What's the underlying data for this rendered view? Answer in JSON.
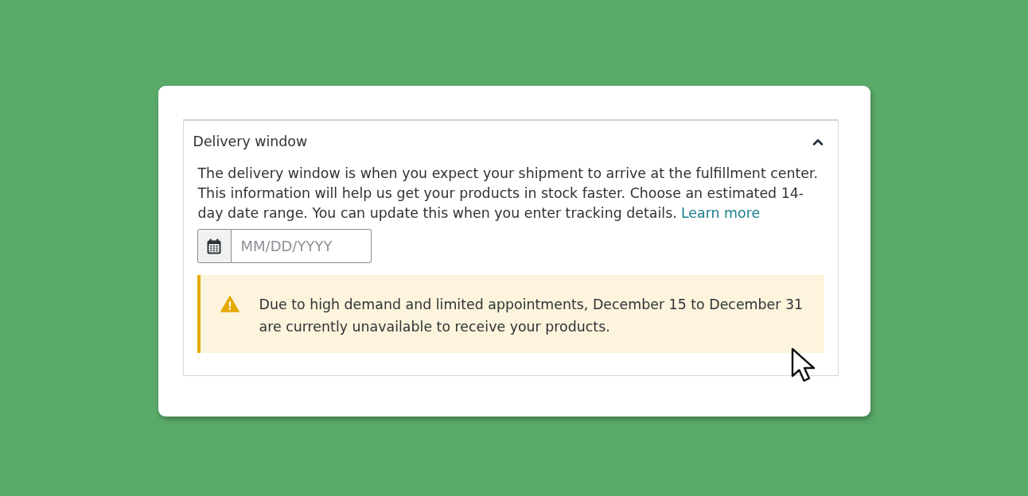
{
  "panel": {
    "title": "Delivery window",
    "expanded": true
  },
  "description": {
    "text": "The delivery window is when you expect your shipment to arrive at the fulfillment center. This information will help us get your products in stock faster. Choose an estimated 14-day date range. You can update this when you enter tracking details.",
    "link": "Learn more"
  },
  "date_field": {
    "placeholder": "MM/DD/YYYY"
  },
  "alert": {
    "kind": "warning",
    "message": "Due to high demand and limited appointments, December 15 to December 31 are currently unavailable to receive your products."
  }
}
